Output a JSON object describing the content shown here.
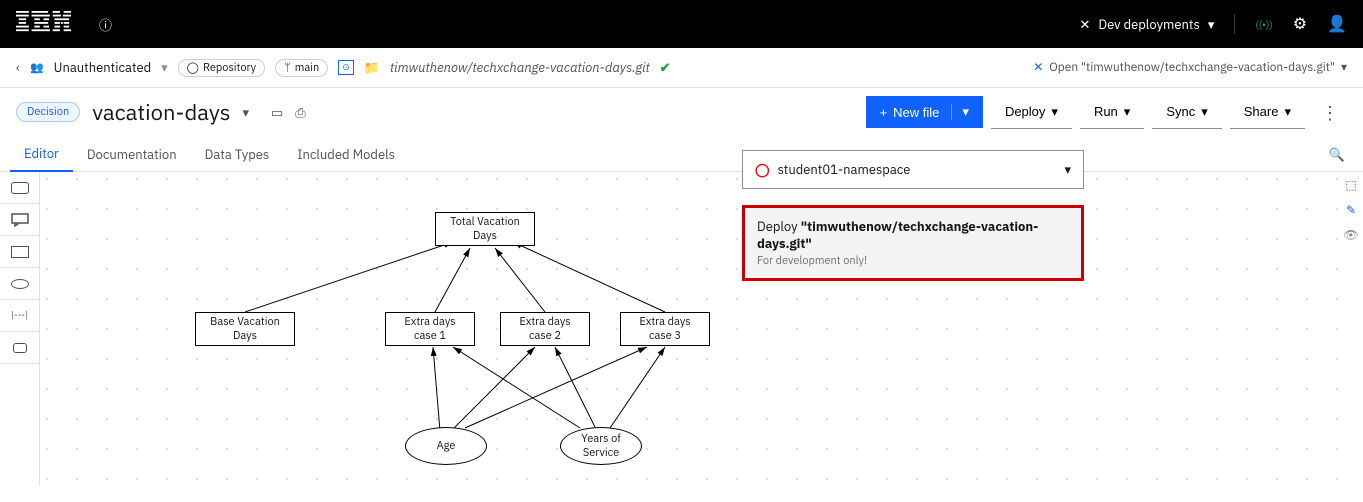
{
  "header": {
    "dev_label": "Dev deployments"
  },
  "breadcrumb": {
    "auth": "Unauthenticated",
    "repo_label": "Repository",
    "branch": "main",
    "path": "timwuthenow/techxchange-vacation-days.git",
    "open_prefix": "Open ",
    "open_path": "\"timwuthenow/techxchange-vacation-days.git\""
  },
  "title": {
    "badge": "Decision",
    "name": "vacation-days"
  },
  "actions": {
    "new_file": "New file",
    "deploy": "Deploy",
    "run": "Run",
    "sync": "Sync",
    "share": "Share"
  },
  "tabs": {
    "editor": "Editor",
    "documentation": "Documentation",
    "data_types": "Data Types",
    "included_models": "Included Models"
  },
  "diagram": {
    "total": "Total Vacation Days",
    "base": "Base Vacation Days",
    "case1": "Extra days case 1",
    "case2": "Extra days case 2",
    "case3": "Extra days case 3",
    "age": "Age",
    "yos": "Years of Service"
  },
  "deploy_popup": {
    "namespace": "student01-namespace",
    "item_prefix": "Deploy ",
    "item_path": "\"timwuthenow/techxchange-vacation-days.git\"",
    "subtitle": "For development only!"
  }
}
